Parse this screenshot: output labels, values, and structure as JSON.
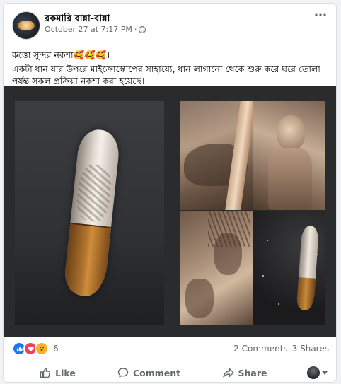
{
  "post": {
    "page_name": "রকমারি রান্না-বান্না",
    "timestamp": "October 27 at 7:17 PM",
    "separator": "·",
    "more_icon": "more-horizontal-icon",
    "text_line1": "কত্তো সুন্দর নকশা🥰🥰🥰।",
    "text_line2": "একটা ধান যার উপরে মাইক্রোস্কোপের সাহায্যে, ধান লাগানো থেকে শুরু করে ঘরে তোলা পর্যন্ত সকল প্রক্রিয়া নকশা করা হয়েছে।"
  },
  "reactions": {
    "icons": [
      "like-icon",
      "love-icon",
      "wow-icon"
    ],
    "count": "6"
  },
  "stats": {
    "comments": "2 Comments",
    "shares": "3 Shares"
  },
  "actions": {
    "like": "Like",
    "comment": "Comment",
    "share": "Share"
  },
  "colors": {
    "accent": "#1877f2",
    "love": "#f33e58",
    "wow": "#f7b125",
    "secondary_text": "#65676b",
    "media_bg": "#2a2b2d"
  }
}
